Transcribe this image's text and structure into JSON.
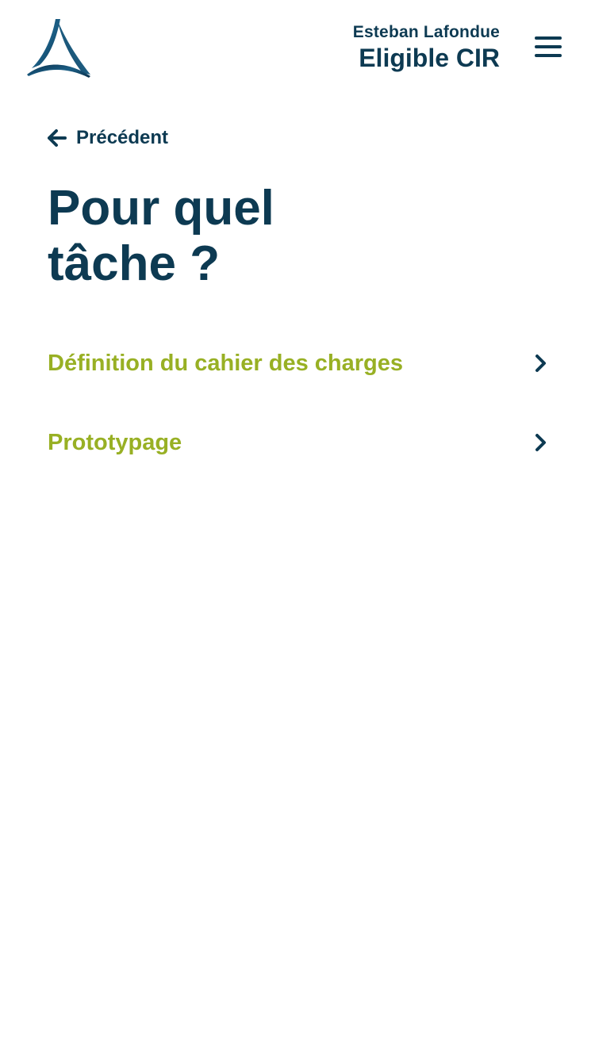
{
  "header": {
    "logo_icon": "triangle-logo-icon",
    "user_name": "Esteban Lafondue",
    "user_status": "Eligible CIR",
    "menu_icon": "hamburger-menu-icon"
  },
  "navigation": {
    "back_label": "Précédent",
    "back_icon": "arrow-left-icon"
  },
  "main": {
    "title": "Pour quel\ntâche ?",
    "options": [
      {
        "label": "Définition du cahier des charges",
        "icon": "chevron-right-icon"
      },
      {
        "label": "Prototypage",
        "icon": "chevron-right-icon"
      }
    ]
  },
  "colors": {
    "primary": "#0d3a52",
    "accent": "#98b024",
    "background": "#ffffff"
  }
}
